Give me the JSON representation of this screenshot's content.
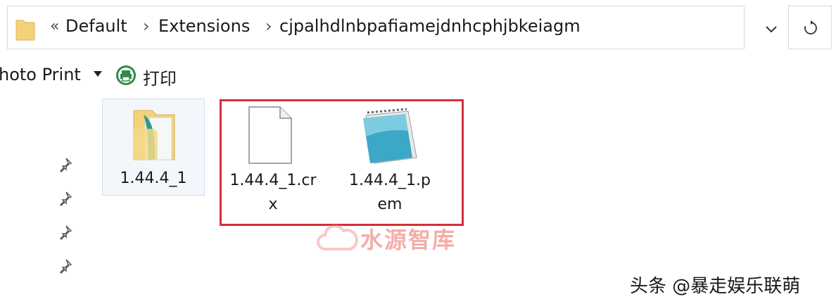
{
  "address_bar": {
    "overflow_label": "«",
    "breadcrumbs": [
      "Default",
      "Extensions",
      "cjpalhdlnbpafiamejdnhcphjbkeiagm"
    ],
    "separator": "›"
  },
  "toolbar": {
    "photo_print_label": "hoto Print",
    "print_label": "打印"
  },
  "items": [
    {
      "name": "1.44.4_1",
      "type": "folder",
      "line1": "1.44.4_1"
    },
    {
      "name": "1.44.4_1.crx",
      "type": "file",
      "line1": "1.44.4_1.cr",
      "line2": "x"
    },
    {
      "name": "1.44.4_1.pem",
      "type": "notepad-file",
      "line1": "1.44.4_1.p",
      "line2": "em"
    }
  ],
  "watermark": {
    "text": "水源智库"
  },
  "credit": {
    "text": "头条 @暴走娱乐联萌"
  },
  "colors": {
    "highlight": "#d2303a",
    "folder": "#f3d27a"
  }
}
